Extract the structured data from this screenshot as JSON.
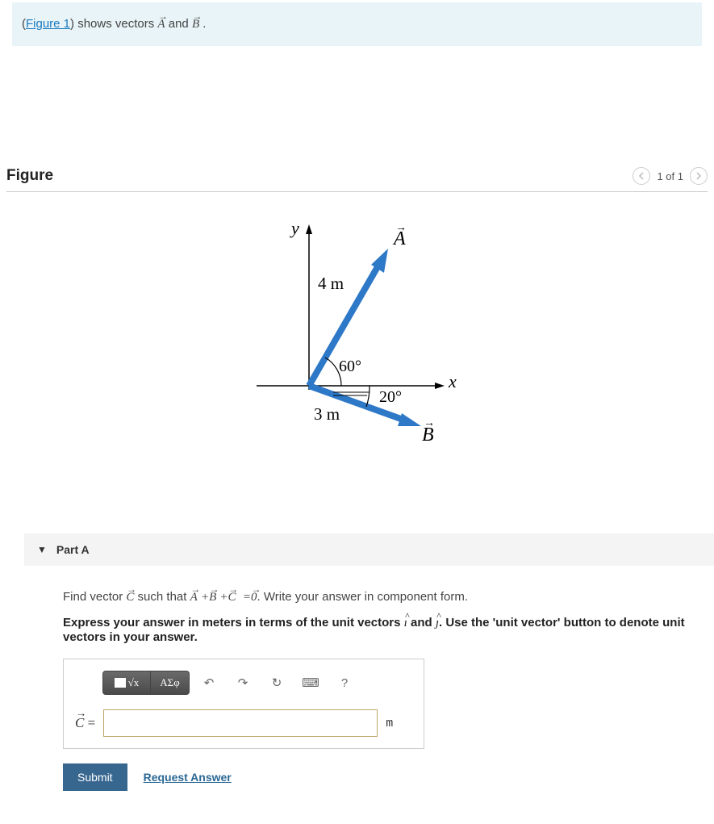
{
  "intro": {
    "link_text": "Figure 1",
    "text_before": "(",
    "text_after_link": ") shows vectors ",
    "vecA": "A",
    "text_and": " and ",
    "vecB": "B",
    "text_end": " ."
  },
  "figure": {
    "title": "Figure",
    "nav_text": "1 of 1",
    "labels": {
      "y": "y",
      "x": "x",
      "A": "A",
      "B": "B",
      "lenA": "4 m",
      "lenB": "3 m",
      "angA": "60°",
      "angB": "20°"
    }
  },
  "partA": {
    "label": "Part A",
    "q1_pre": "Find vector ",
    "q1_vecC": "C",
    "q1_mid": " such that ",
    "q1_eq_A": "A",
    "q1_eq_plus1": "+",
    "q1_eq_B": "B",
    "q1_eq_plus2": "+",
    "q1_eq_C": "C",
    "q1_eq_eq": "=",
    "q1_eq_0": "0",
    "q1_post": ". Write your answer in component form.",
    "q2_pre": "Express your answer in meters in terms of the unit vectors ",
    "q2_i": "ı",
    "q2_and": " and ",
    "q2_j": "ȷ",
    "q2_post": ". Use the 'unit vector' button to denote unit vectors in your answer.",
    "toolbar": {
      "templates": "x",
      "greek": "ΑΣφ",
      "undo_icon": "↶",
      "redo_icon": "↷",
      "reset_icon": "↻",
      "keyboard_icon": "⌨",
      "help_icon": "?"
    },
    "lhs_vec": "C",
    "lhs_eq": " = ",
    "unit": "m",
    "submit": "Submit",
    "request": "Request Answer"
  }
}
